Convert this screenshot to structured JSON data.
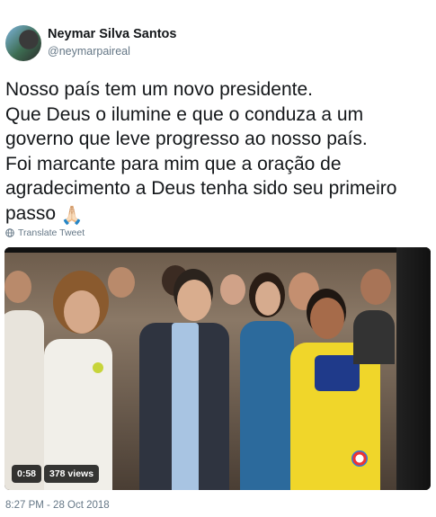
{
  "user": {
    "name": "Neymar Silva Santos",
    "handle": "@neymarpaireal"
  },
  "tweet": {
    "text": "Nosso país tem um novo presidente.\nQue Deus o ilumine e que o conduza a um governo que leve progresso ao nosso país.\nFoi marcante para mim que a oração de agradecimento a Deus  tenha sido seu primeiro passo",
    "emoji": "🙏🏻",
    "translate_label": "Translate Tweet"
  },
  "video": {
    "duration": "0:58",
    "views": "378 views"
  },
  "meta": {
    "timestamp": "8:27 PM - 28 Oct 2018"
  },
  "icons": {
    "globe": "globe-icon",
    "avatar": "avatar"
  },
  "colors": {
    "text": "#14171a",
    "secondary": "#657786"
  }
}
